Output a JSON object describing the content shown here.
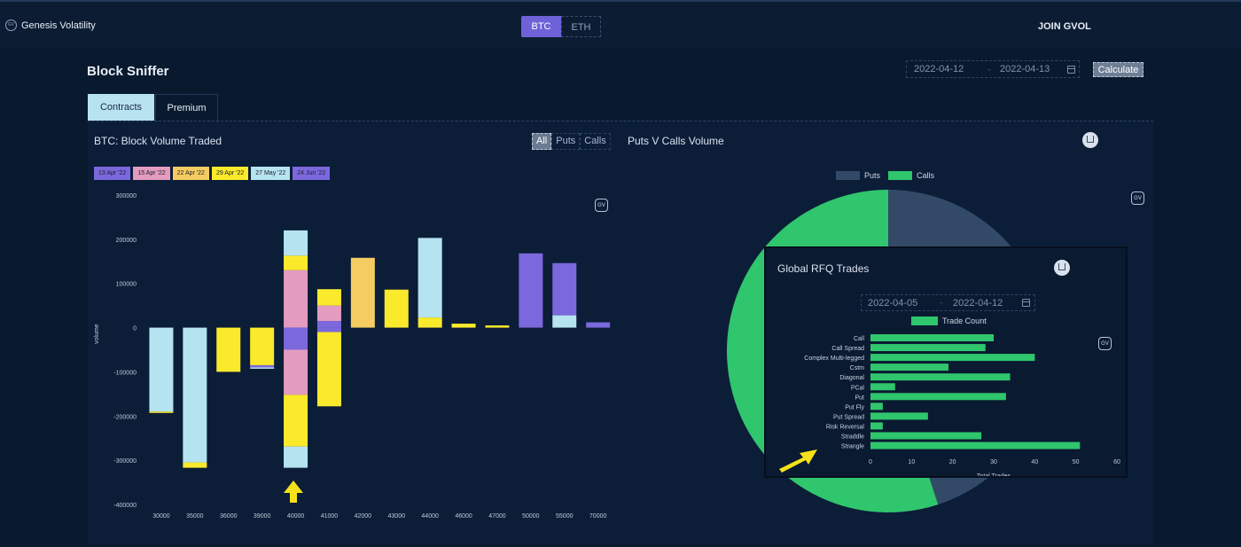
{
  "app": {
    "brand": "Genesis Volatility",
    "brand_logo": "GV",
    "join": "JOIN GVOL"
  },
  "asset_toggle": {
    "btc": "BTC",
    "eth": "ETH"
  },
  "page": {
    "title": "Block Sniffer"
  },
  "date_range": {
    "start": "2022-04-12",
    "end": "2022-04-13",
    "arrow": "→"
  },
  "calculate_label": "Calculate",
  "tabs": {
    "contracts": "Contracts",
    "premium": "Premium"
  },
  "block_volume": {
    "title": "BTC: Block Volume Traded",
    "filter": {
      "all": "All",
      "puts": "Puts",
      "calls": "Calls"
    },
    "gv_badge": "GV",
    "expiries": [
      {
        "label": "13 Apr '22",
        "color": "#7b68dc"
      },
      {
        "label": "15 Apr '22",
        "color": "#e39bbf"
      },
      {
        "label": "22 Apr '22",
        "color": "#f5cc62"
      },
      {
        "label": "29 Apr '22",
        "color": "#fbea2b"
      },
      {
        "label": "27 May '22",
        "color": "#b5e3f0"
      },
      {
        "label": "24 Jun '22",
        "color": "#7b68dc"
      }
    ]
  },
  "pie": {
    "title": "Puts V Calls Volume",
    "gv_badge": "GV",
    "legend": {
      "puts": "Puts",
      "calls": "Calls"
    },
    "colors": {
      "puts": "#324a68",
      "calls": "#2fc66d"
    }
  },
  "rfq": {
    "title": "Global RFQ Trades",
    "date_start": "2022-04-05",
    "date_end": "2022-04-12",
    "gv_badge": "GV",
    "legend": "Trade Count"
  },
  "chart_data": [
    {
      "type": "bar",
      "title": "BTC: Block Volume Traded",
      "ylabel": "volume",
      "ylim": [
        -400000,
        300000
      ],
      "yticks": [
        300000,
        200000,
        100000,
        0,
        -100000,
        -200000,
        -300000,
        -400000
      ],
      "categories": [
        "30000",
        "35000",
        "36000",
        "39000",
        "40000",
        "41000",
        "42000",
        "43000",
        "44000",
        "46000",
        "47000",
        "50000",
        "55000",
        "70000"
      ],
      "grid": false,
      "stacked": true,
      "stacks": [
        [
          [
            "#b5e3f0",
            -190000
          ],
          [
            "#fbea2b",
            -3000
          ]
        ],
        [
          [
            "#b5e3f0",
            -305000
          ],
          [
            "#fbea2b",
            -12000
          ]
        ],
        [
          [
            "#fbea2b",
            -100000
          ]
        ],
        [
          [
            "#fbea2b",
            -85000
          ],
          [
            "#7b68dc",
            -5000
          ],
          [
            "#b5e3f0",
            -3000
          ]
        ],
        [
          [
            "#e39bbf",
            130000
          ],
          [
            "#fbea2b",
            33000
          ],
          [
            "#b5e3f0",
            57000
          ],
          [
            "#7b68dc",
            -50000
          ],
          [
            "#e39bbf",
            -102000
          ],
          [
            "#fbea2b",
            -117000
          ],
          [
            "#b5e3f0",
            -48000
          ]
        ],
        [
          [
            "#7b68dc",
            15000
          ],
          [
            "#e39bbf",
            35000
          ],
          [
            "#fbea2b",
            37000
          ],
          [
            "#7b68dc",
            -10000
          ],
          [
            "#fbea2b",
            -168000
          ]
        ],
        [
          [
            "#f5cc62",
            158000
          ]
        ],
        [
          [
            "#fbea2b",
            86000
          ]
        ],
        [
          [
            "#fbea2b",
            23000
          ],
          [
            "#b5e3f0",
            180000
          ]
        ],
        [
          [
            "#fbea2b",
            9000
          ]
        ],
        [
          [
            "#fbea2b",
            5000
          ]
        ],
        [
          [
            "#7b68dc",
            168000
          ]
        ],
        [
          [
            "#b5e3f0",
            28000
          ],
          [
            "#7b68dc",
            118000
          ]
        ],
        [
          [
            "#7b68dc",
            12000
          ]
        ]
      ]
    },
    {
      "type": "pie",
      "title": "Puts V Calls Volume",
      "labels": [
        "Puts",
        "Calls"
      ],
      "values": [
        45,
        55
      ],
      "legend_position": "top"
    },
    {
      "type": "bar",
      "orientation": "horizontal",
      "title": "Global RFQ Trades",
      "categories": [
        "Call",
        "Call Spread",
        "Complex Multi-legged",
        "Cstm",
        "Diagonal",
        "PCal",
        "Put",
        "Put Fly",
        "Put Spread",
        "Risk Reversal",
        "Straddle",
        "Strangle"
      ],
      "series": [
        {
          "name": "Trade Count",
          "values": [
            30,
            28,
            40,
            19,
            34,
            6,
            33,
            3,
            14,
            3,
            27,
            51
          ]
        }
      ],
      "xlim": [
        0,
        60
      ],
      "xticks": [
        0,
        10,
        20,
        30,
        40,
        50,
        60
      ],
      "xlabel": "Total Trades",
      "color": "#2fc66d"
    }
  ]
}
